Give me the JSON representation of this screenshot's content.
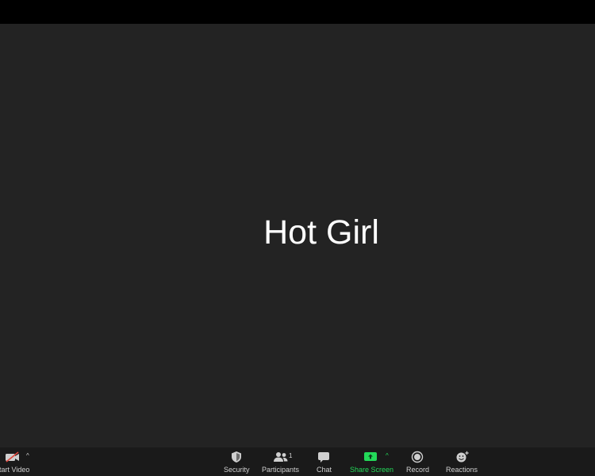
{
  "meeting": {
    "participant_name": "Hot Girl"
  },
  "toolbar": {
    "start_video_label": "Start Video",
    "security_label": "Security",
    "participants_label": "Participants",
    "participants_count": "1",
    "chat_label": "Chat",
    "share_screen_label": "Share Screen",
    "record_label": "Record",
    "reactions_label": "Reactions",
    "caret": "^"
  },
  "icons": {
    "video_off": "video-off-icon",
    "security": "shield-icon",
    "participants": "people-icon",
    "chat": "chat-bubble-icon",
    "share_screen": "share-screen-icon",
    "record": "record-icon",
    "reactions": "emoji-plus-icon"
  },
  "colors": {
    "background": "#232323",
    "top_bar": "#000000",
    "toolbar": "#1a1a1a",
    "share_green": "#23d959",
    "video_off_red": "#e0463c",
    "toolbar_text": "#d0d0d0"
  }
}
